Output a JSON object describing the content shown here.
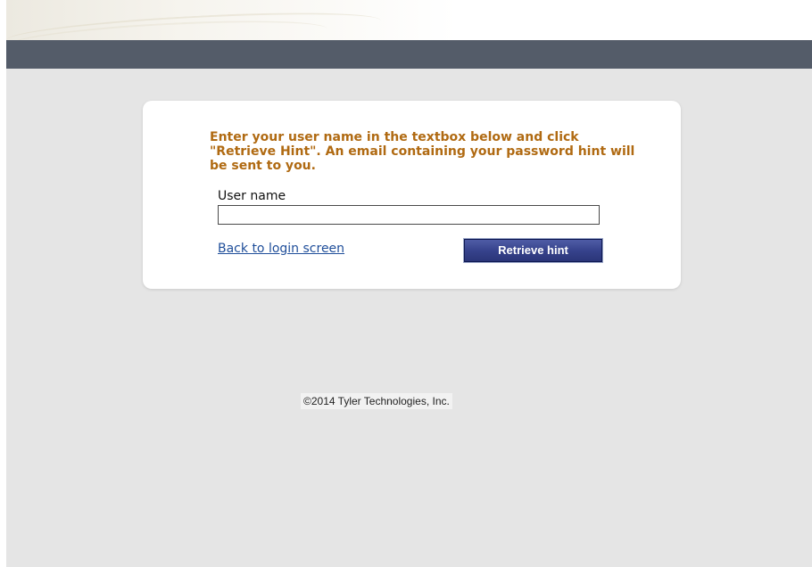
{
  "instructions": "Enter your user name in the textbox below and click \"Retrieve Hint\". An email containing your password hint will be sent to you.",
  "form": {
    "username_label": "User name",
    "username_value": "",
    "back_link": "Back to login screen",
    "retrieve_button": "Retrieve hint"
  },
  "footer": {
    "copyright": "©2014 Tyler Technologies, Inc."
  },
  "colors": {
    "nav_bar": "#545c69",
    "background": "#e5e5e5",
    "instruction_text": "#b06a12",
    "link": "#1f4e9a",
    "button": "#35418a"
  }
}
